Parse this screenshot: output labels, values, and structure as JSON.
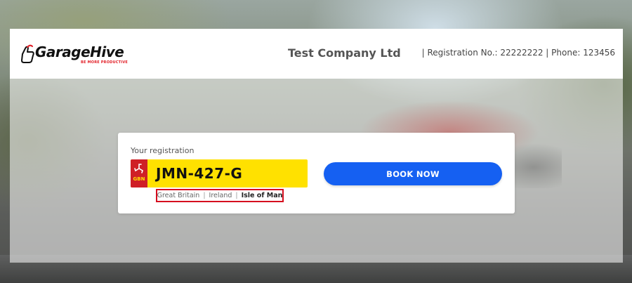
{
  "brand": {
    "name": "GarageHive",
    "tagline": "BE MORE PRODUCTIVE",
    "accent_color": "#e21e26",
    "logo_icon": "thumbs-up-icon"
  },
  "header": {
    "company_name": "Test Company Ltd",
    "company_info": "|  Registration No.: 22222222  |  Phone: 123456"
  },
  "card": {
    "label": "Your registration",
    "plate": {
      "number": "JMN-427-G",
      "country_code": "GBN",
      "flag_icon": "triskelion-icon",
      "plate_color": "#ffe100",
      "flag_color": "#cf1f26"
    },
    "regions": [
      {
        "label": "Great Britain",
        "active": false
      },
      {
        "label": "Ireland",
        "active": false
      },
      {
        "label": "Isle of Man",
        "active": true
      }
    ],
    "region_separator": "|",
    "book_button": {
      "label": "BOOK NOW",
      "color": "#1560f2"
    }
  }
}
